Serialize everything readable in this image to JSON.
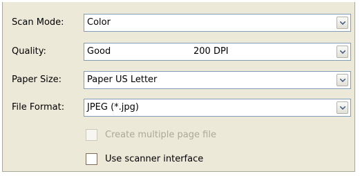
{
  "fields": [
    {
      "label": "Scan Mode:",
      "value": "Color",
      "extra": ""
    },
    {
      "label": "Quality:",
      "value": "Good",
      "extra": "200 DPI"
    },
    {
      "label": "Paper Size:",
      "value": "Paper US Letter",
      "extra": ""
    },
    {
      "label": "File Format:",
      "value": "JPEG (*.jpg)",
      "extra": ""
    }
  ],
  "options": {
    "multi_page": {
      "label": "Create multiple page file",
      "checked": false,
      "enabled": false
    },
    "scanner_interface": {
      "label": "Use scanner interface",
      "checked": false,
      "enabled": true
    }
  },
  "colors": {
    "panel_bg": "#ece9d8",
    "field_border": "#7f9db9",
    "disabled_text": "#aca899"
  }
}
